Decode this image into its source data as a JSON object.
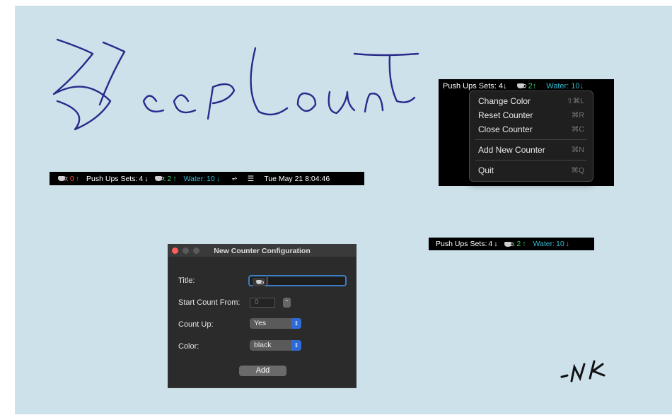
{
  "logo_text": "BeepCount",
  "signature": "-NK",
  "menubar_main": {
    "coffee_count": "0",
    "coffee_arrow": "↑",
    "pushups_label": "Push Ups Sets:",
    "pushups_count": "4",
    "pushups_arrow": "↓",
    "cup_count": "2",
    "cup_arrow": "↑",
    "water_label": "Water:",
    "water_count": "10",
    "water_arrow": "↓",
    "datetime": "Tue May 21  8:04:46"
  },
  "menubar_small": {
    "pushups_label": "Push Ups Sets:",
    "pushups_count": "4",
    "pushups_arrow": "↓",
    "cup_count": "2",
    "cup_arrow": "↑",
    "water_label": "Water:",
    "water_count": "10",
    "water_arrow": "↓"
  },
  "context_menu": {
    "header_pushups": "Push Ups Sets: 4↓",
    "header_cup": ": 2↑",
    "header_water": "Water: 10↓",
    "items": [
      {
        "label": "Change Color",
        "shortcut": "⇧⌘L"
      },
      {
        "label": "Reset Counter",
        "shortcut": "⌘R"
      },
      {
        "label": "Close Counter",
        "shortcut": "⌘C"
      },
      {
        "label": "Add New Counter",
        "shortcut": "⌘N"
      },
      {
        "label": "Quit",
        "shortcut": "⌘Q"
      }
    ]
  },
  "dialog": {
    "title": "New Counter Configuration",
    "title_label": "Title:",
    "start_label": "Start Count From:",
    "start_value": "0",
    "countup_label": "Count Up:",
    "countup_value": "Yes",
    "color_label": "Color:",
    "color_value": "black",
    "add_button": "Add"
  },
  "colors": {
    "background": "#cce1e9",
    "up_green": "#39d46a",
    "down_red": "#ff4a3a",
    "water_cyan": "#35bcd2",
    "accent_blue": "#2f6bd6",
    "logo_ink": "#2a2a8c"
  }
}
